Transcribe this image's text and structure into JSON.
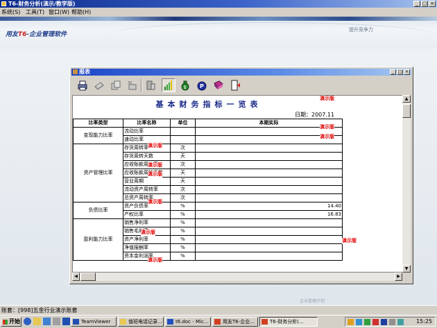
{
  "app": {
    "title": "T6-财务分析(演示/教学版)",
    "window_buttons": [
      "_",
      "□",
      "×"
    ]
  },
  "menu": [
    "系统(S)",
    "工具(T)",
    "窗口(W)",
    "帮助(H)"
  ],
  "banner": {
    "logo_prefix": "用友",
    "logo_brand": "T6",
    "logo_suffix": "-企业管理软件",
    "slogan": "提升竞争力",
    "footer_ghost": "企业管理计划"
  },
  "report_window": {
    "title": "报表",
    "window_buttons": [
      "_",
      "□",
      "×"
    ],
    "toolbar": [
      "printer-icon",
      "export-icon",
      "copy-icon",
      "compute-icon",
      "bar-chart-icon",
      "money-bag-icon",
      "parking-icon",
      "book-icon",
      "exit-door-icon"
    ]
  },
  "report": {
    "title": "基本财务指标一览表",
    "date_label": "日期：2007.11",
    "watermark": "演示版",
    "headers": [
      "比率类型",
      "比率名称",
      "单位",
      "本期实际"
    ],
    "groups": [
      {
        "category": "变现能力比率",
        "rows": [
          {
            "name": "流动比率",
            "unit": "",
            "value": ""
          },
          {
            "name": "速动比率",
            "unit": "",
            "value": ""
          }
        ]
      },
      {
        "category": "资产管理比率",
        "rows": [
          {
            "name": "存货周转率",
            "unit": "次",
            "value": ""
          },
          {
            "name": "存货周转天数",
            "unit": "天",
            "value": ""
          },
          {
            "name": "应收账款周转率",
            "unit": "次",
            "value": ""
          },
          {
            "name": "应收账款周转天数",
            "unit": "天",
            "value": ""
          },
          {
            "name": "营业周期",
            "unit": "天",
            "value": ""
          },
          {
            "name": "流动资产周转率",
            "unit": "次",
            "value": ""
          },
          {
            "name": "总资产周转率",
            "unit": "次",
            "value": ""
          }
        ]
      },
      {
        "category": "负债比率",
        "rows": [
          {
            "name": "资产负债率",
            "unit": "%",
            "value": "14.40"
          },
          {
            "name": "产权比率",
            "unit": "%",
            "value": "16.83"
          }
        ]
      },
      {
        "category": "盈利能力比率",
        "rows": [
          {
            "name": "销售净利率",
            "unit": "%",
            "value": ""
          },
          {
            "name": "销售毛利率",
            "unit": "%",
            "value": ""
          },
          {
            "name": "资产净利率",
            "unit": "%",
            "value": ""
          },
          {
            "name": "净值报酬率",
            "unit": "%",
            "value": ""
          },
          {
            "name": "资本金利润率",
            "unit": "%",
            "value": ""
          }
        ]
      }
    ]
  },
  "statusbar": {
    "text": "账套：[998]五金行业演示账套"
  },
  "taskbar": {
    "start_label": "开始",
    "tasks": [
      {
        "label": "TeamViewer",
        "active": false
      },
      {
        "label": "值班电话记录...",
        "active": false
      },
      {
        "label": "t6.doc - Mic...",
        "active": false
      },
      {
        "label": "用友T6-企业...",
        "active": false
      },
      {
        "label": "T6-财务分析(...",
        "active": true
      }
    ],
    "clock": "15:25"
  },
  "colors": {
    "title_blue": "#0b2a8a",
    "report_title": "#1a2a8a",
    "watermark_red": "#e00000",
    "face": "#d4d0c8"
  }
}
